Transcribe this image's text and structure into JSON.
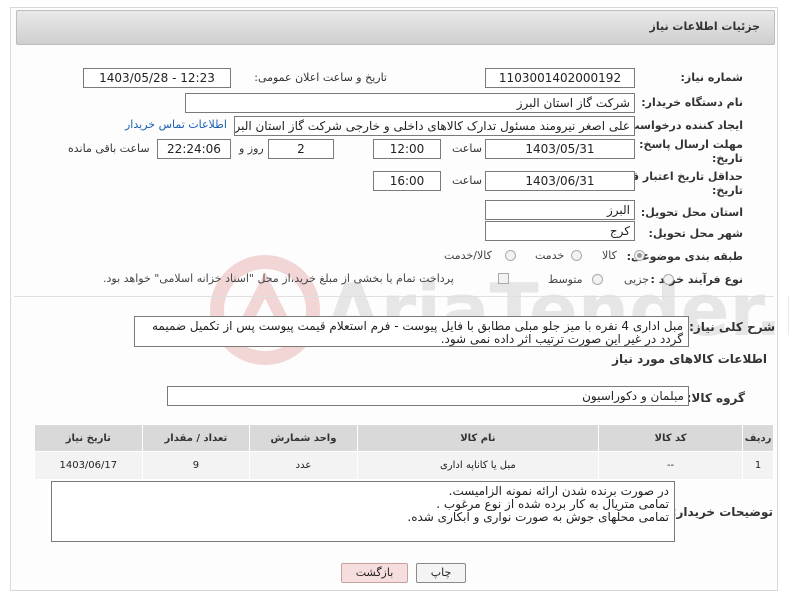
{
  "header": {
    "title": "جزئیات اطلاعات نیاز"
  },
  "fields": {
    "need_number_label": "شماره نیاز:",
    "need_number": "1103001402000192",
    "announce_label": "تاریخ و ساعت اعلان عمومی:",
    "announce_value": "1403/05/28 - 12:23",
    "buyer_org_label": "نام دستگاه خریدار:",
    "buyer_org": "شرکت گاز استان البرز",
    "creator_label": "ایجاد کننده درخواست:",
    "creator": "علی اصغر نیرومند مسئول تدارک کالاهای داخلی و خارجی شرکت گاز استان البرز",
    "contact_link": "اطلاعات تماس خریدار",
    "deadline_label_1": "مهلت ارسال پاسخ: تا",
    "deadline_label_2": "تاریخ:",
    "deadline_date": "1403/05/31",
    "time_label": "ساعت",
    "deadline_time": "12:00",
    "days_value": "2",
    "days_label": "روز و",
    "remaining_time": "22:24:06",
    "remaining_label": "ساعت باقی مانده",
    "validity_label_1": "حداقل تاریخ اعتبار قیمت: تا",
    "validity_label_2": "تاریخ:",
    "validity_date": "1403/06/31",
    "validity_time": "16:00",
    "province_label": "استان محل تحویل:",
    "province": "البرز",
    "city_label": "شهر محل تحویل:",
    "city": "کرج",
    "category_label": "طبقه بندی موضوعی:",
    "category_options": [
      "کالا",
      "خدمت",
      "کالا/خدمت"
    ],
    "purchase_label": "نوع فرآیند خرید :",
    "purchase_options": [
      "جزیی",
      "متوسط"
    ],
    "payment_note": "پرداخت تمام یا بخشی از مبلغ خرید،از محل \"اسناد خزانه اسلامی\" خواهد بود."
  },
  "description": {
    "label": "شرح کلی نیاز:",
    "text": "مبل اداری 4 نفره با میز جلو مبلی مطابق با فایل پیوست - فرم استعلام قیمت پیوست پس از تکمیل ضمیمه گردد در غیر این صورت ترتیب اثر داده نمی شود."
  },
  "goods": {
    "section_title": "اطلاعات کالاهای مورد نیاز",
    "group_label": "گروه کالا:",
    "group_value": "مبلمان و دکوراسیون",
    "columns": [
      "ردیف",
      "کد کالا",
      "نام کالا",
      "واحد شمارش",
      "تعداد / مقدار",
      "تاریخ نیاز"
    ],
    "rows": [
      {
        "index": "1",
        "code": "--",
        "name": "مبل یا کاناپه اداری",
        "unit": "عدد",
        "qty": "9",
        "date": "1403/06/17"
      }
    ]
  },
  "buyer_notes": {
    "label": "توضیحات خریدار:",
    "text": "در صورت برنده شدن ارائه نمونه الزامیست.\nتمامی متریال به کار برده شده از نوع مرغوب .\nتمامی محلهای جوش به صورت نواری و ابکاری شده."
  },
  "buttons": {
    "print": "چاپ",
    "back": "بازگشت"
  },
  "watermark": "AriaTender.neT",
  "colors": {
    "link": "#1a5fb4",
    "watermark": "#e3e3e3",
    "watermark_accent": "#f2d6d6",
    "back_button_bg": "#f7dede"
  }
}
